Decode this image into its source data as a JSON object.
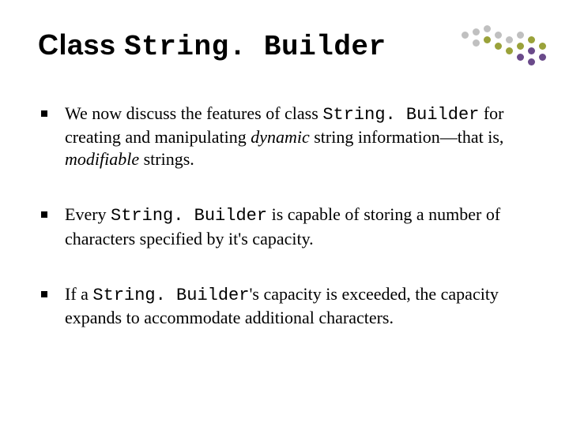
{
  "title_prefix": "Class ",
  "title_code": "String. Builder",
  "bullets": [
    {
      "t1": "We now discuss the features of class ",
      "c1": "String. Builder",
      "t2": " for creating and manipulating ",
      "i1": "dynamic",
      "t3": " string information—that is, ",
      "i2": "modifiable",
      "t4": " strings."
    },
    {
      "t1": "Every ",
      "c1": "String. Builder",
      "t2": " is capable of storing a number of characters specified by it's capacity.",
      "i1": "",
      "t3": "",
      "i2": "",
      "t4": ""
    },
    {
      "t1": "If a ",
      "c1": "String. Builder",
      "t2": "'s capacity is exceeded, the capacity expands to accommodate additional characters.",
      "i1": "",
      "t3": "",
      "i2": "",
      "t4": ""
    }
  ],
  "dot_colors": {
    "gray": "#c0c0c0",
    "olive": "#9aa23a",
    "purple": "#6a4a8a"
  }
}
